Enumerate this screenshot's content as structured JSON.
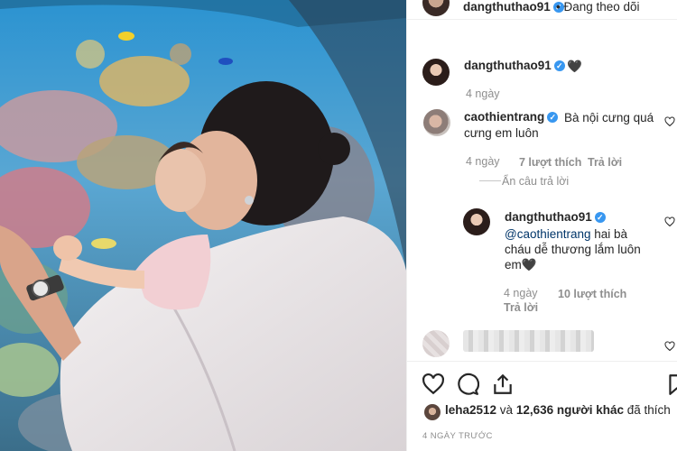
{
  "header": {
    "username": "dangthuthao91",
    "verified_glyph": "✓",
    "follow_status": "• Đang theo dõi"
  },
  "comments": [
    {
      "username": "dangthuthao91",
      "verified_glyph": "✓",
      "text": "🖤",
      "time": "4 ngày"
    },
    {
      "username": "caothientrang",
      "verified_glyph": "✓",
      "text_line1": "Bà nội cưng quá",
      "text_line2": "cưng em luôn",
      "time": "4 ngày",
      "likes": "7 lượt thích",
      "reply_label": "Trả lời",
      "hide_replies": "Ẩn câu trả lời"
    },
    {
      "username": "dangthuthao91",
      "verified_glyph": "✓",
      "mention": "@caothientrang",
      "text_line1": " hai bà",
      "text_line2": "cháu dễ thương lắm luôn",
      "text_line3": "em🖤",
      "time": "4 ngày",
      "likes": "10 lượt thích",
      "reply_label": "Trả lời"
    }
  ],
  "actions": {
    "like_icon": "heart-icon",
    "comment_icon": "comment-icon",
    "share_icon": "share-icon",
    "save_icon": "bookmark-icon"
  },
  "likes_summary": {
    "first_user": "leha2512",
    "connector": " và ",
    "count_text": "12,636 người khác",
    "suffix": " đã thích"
  },
  "post_date": "4 NGÀY TRƯỚC",
  "colors": {
    "verified": "#3897f0",
    "muted": "#8e8e8e",
    "text": "#262626",
    "mention": "#003569"
  }
}
